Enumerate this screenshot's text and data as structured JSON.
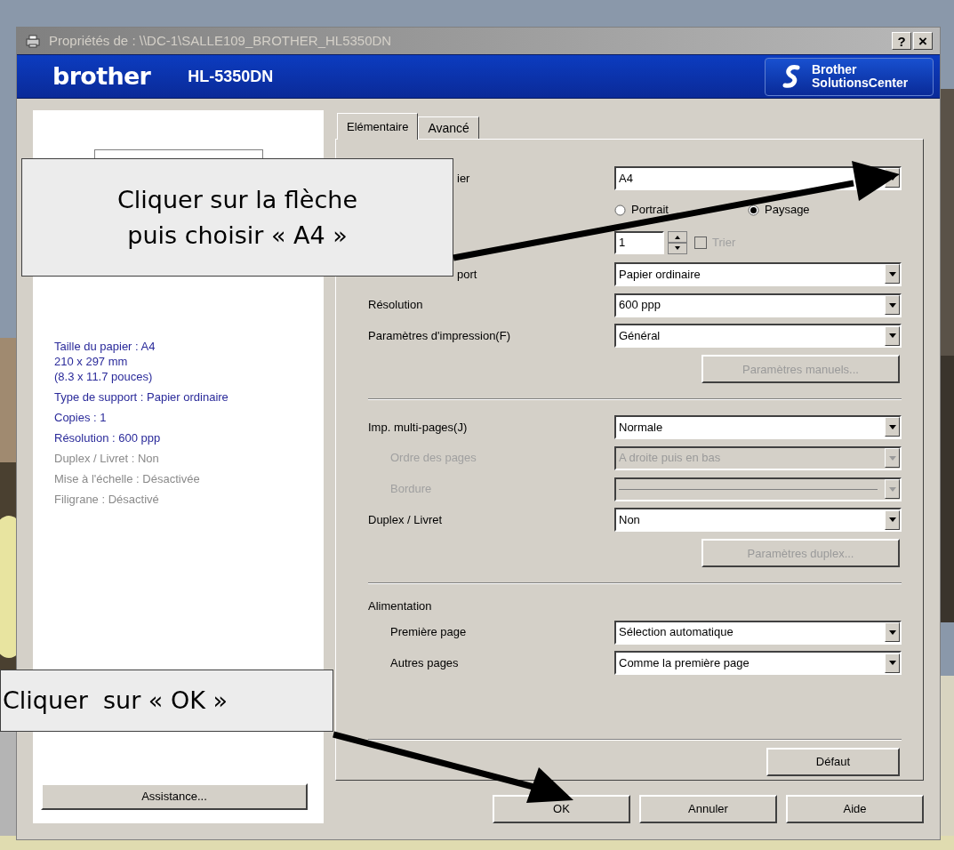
{
  "window": {
    "title": "Propriétés de : \\\\DC-1\\SALLE109_BROTHER_HL5350DN",
    "help_button": "?",
    "close_button": "×"
  },
  "banner": {
    "brand": "brother",
    "model": "HL-5350DN",
    "solutions_lines": [
      "Brother",
      "SolutionsCenter"
    ]
  },
  "summary": [
    {
      "lines": [
        "Taille du papier : A4",
        "210 x 297 mm",
        "(8.3 x 11.7 pouces)"
      ],
      "active": true
    },
    {
      "lines": [
        "Type de support : Papier ordinaire"
      ],
      "active": true
    },
    {
      "lines": [
        "Copies : 1"
      ],
      "active": true
    },
    {
      "lines": [
        "Résolution : 600 ppp"
      ],
      "active": true
    },
    {
      "lines": [
        "Duplex / Livret : Non"
      ],
      "active": false
    },
    {
      "lines": [
        "Mise à l'échelle : Désactivée"
      ],
      "active": false
    },
    {
      "lines": [
        "Filigrane : Désactivé"
      ],
      "active": false
    }
  ],
  "assistance_button": "Assistance...",
  "tabs": [
    {
      "label": "Elémentaire",
      "selected": true
    },
    {
      "label": "Avancé",
      "selected": false
    }
  ],
  "settings": [
    {
      "kind": "select",
      "label": "ier",
      "value": "A4",
      "disabled": false,
      "indented": false,
      "covered": true
    },
    {
      "kind": "radio",
      "options": [
        {
          "label": "Portrait",
          "selected": false
        },
        {
          "label": "Paysage",
          "selected": true
        }
      ]
    },
    {
      "kind": "spin",
      "value": "1",
      "checkbox": {
        "label": "Trier",
        "checked": false,
        "disabled": true
      }
    },
    {
      "kind": "select",
      "label": "port",
      "value": "Papier ordinaire",
      "disabled": false,
      "indented": false,
      "covered": true
    },
    {
      "kind": "select",
      "label": "Résolution",
      "value": "600 ppp",
      "disabled": false,
      "indented": false,
      "covered": false
    },
    {
      "kind": "select",
      "label": "Paramètres d'impression(F)",
      "value": "Général",
      "disabled": false,
      "indented": false,
      "covered": false
    },
    {
      "kind": "button",
      "label": "Paramètres manuels...",
      "disabled": true
    },
    {
      "kind": "divider"
    },
    {
      "kind": "select",
      "label": "Imp. multi-pages(J)",
      "value": "Normale",
      "disabled": false,
      "indented": false,
      "covered": false
    },
    {
      "kind": "select",
      "label": "Ordre des pages",
      "value": "A droite puis en bas",
      "disabled": true,
      "indented": true,
      "covered": false
    },
    {
      "kind": "select",
      "label": "Bordure",
      "disabled": true,
      "indented": true,
      "covered": false
    },
    {
      "kind": "select",
      "label": "Duplex / Livret",
      "value": "Non",
      "disabled": false,
      "indented": false,
      "covered": false
    },
    {
      "kind": "button",
      "label": "Paramètres duplex...",
      "disabled": true
    },
    {
      "kind": "divider"
    },
    {
      "kind": "heading",
      "label": "Alimentation"
    },
    {
      "kind": "select",
      "label": "Première page",
      "value": "Sélection automatique",
      "disabled": false,
      "indented": true,
      "covered": false
    },
    {
      "kind": "select",
      "label": "Autres pages",
      "value": "Comme la première page",
      "disabled": false,
      "indented": true,
      "covered": false
    },
    {
      "kind": "divider"
    },
    {
      "kind": "button",
      "label": "Défaut",
      "disabled": false
    }
  ],
  "buttons": [
    "OK",
    "Annuler",
    "Aide"
  ],
  "callouts": [
    {
      "lines": [
        "Cliquer sur la flèche",
        "puis choisir « A4 »"
      ]
    },
    {
      "lines": [
        "Cliquer  sur « OK »"
      ]
    }
  ]
}
